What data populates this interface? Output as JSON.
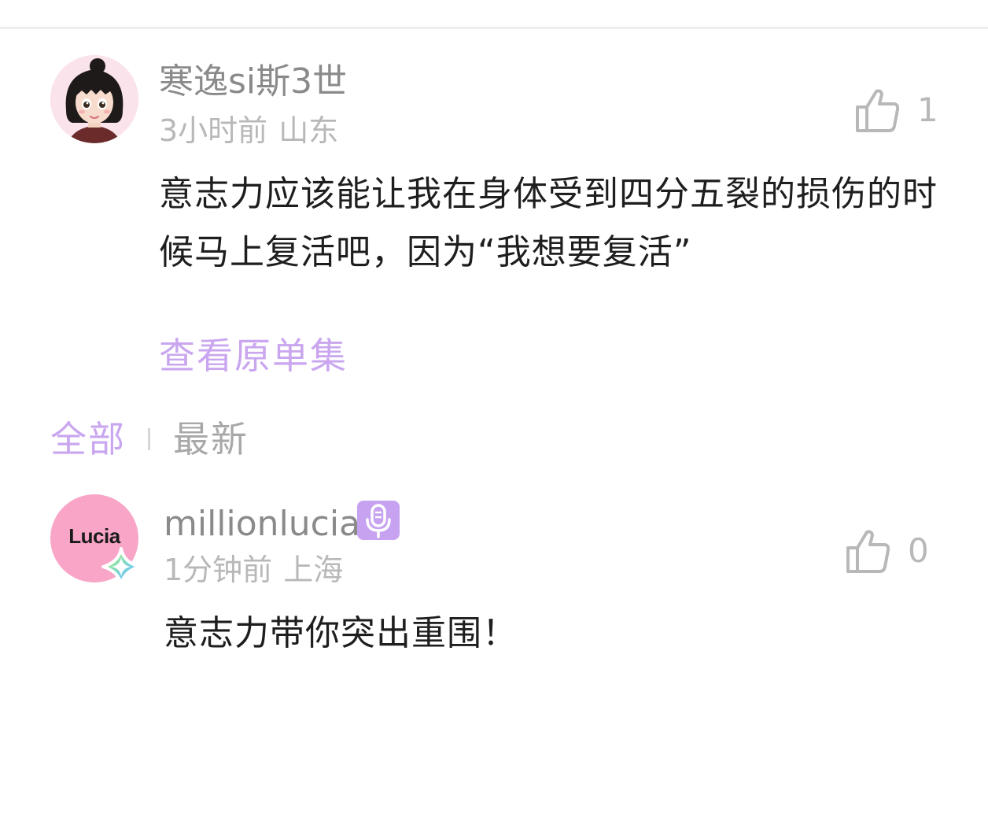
{
  "comments": [
    {
      "username": "寒逸si斯3世",
      "time": "3小时前",
      "region": "山东",
      "like_count": "1",
      "text": "意志力应该能让我在身体受到四分五裂的损伤的时候马上复活吧，因为“我想要复活”",
      "view_original": "查看原单集",
      "avatar_icon": "cartoon-girl-avatar"
    },
    {
      "username": "millionlucia",
      "badge_icon": "microphone-icon",
      "avatar_text": "Lucia",
      "time": "1分钟前",
      "region": "上海",
      "like_count": "0",
      "text": "意志力带你突出重围！"
    }
  ],
  "sort_tabs": {
    "all": "全部",
    "latest": "最新",
    "active": "all"
  },
  "colors": {
    "accent": "#c9a6ef",
    "username": "#8a8a8a",
    "meta": "#b8b8b8",
    "body_text": "#1e1e1e",
    "lucia_avatar_bg": "#f8a5c7",
    "mic_badge": "#c6a2f0"
  }
}
